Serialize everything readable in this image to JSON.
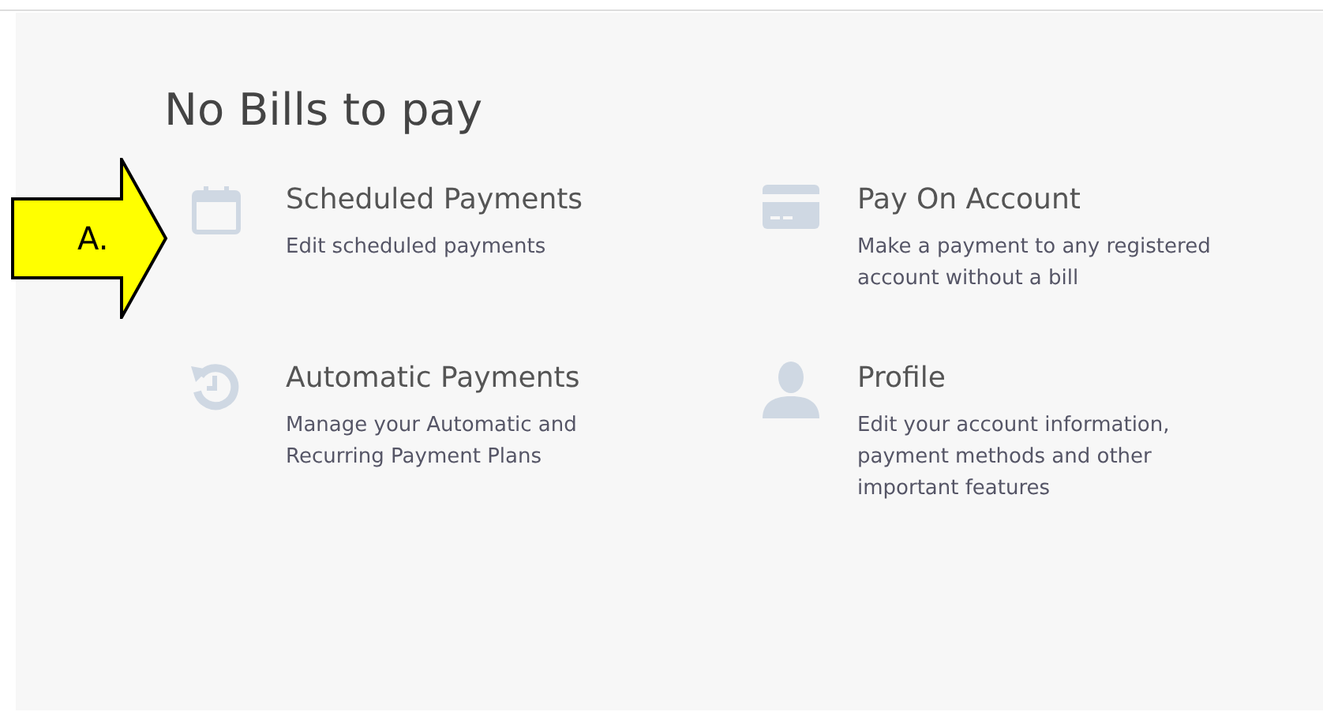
{
  "heading": "No Bills to pay",
  "cards": [
    {
      "title": "Scheduled Payments",
      "description": "Edit scheduled payments"
    },
    {
      "title": "Pay On Account",
      "description": "Make a payment to any registered account without a bill"
    },
    {
      "title": "Automatic Payments",
      "description": "Manage your Automatic and Recurring Payment Plans"
    },
    {
      "title": "Profile",
      "description": "Edit your account information, payment methods and other important features"
    }
  ],
  "callout": {
    "label": "A."
  }
}
